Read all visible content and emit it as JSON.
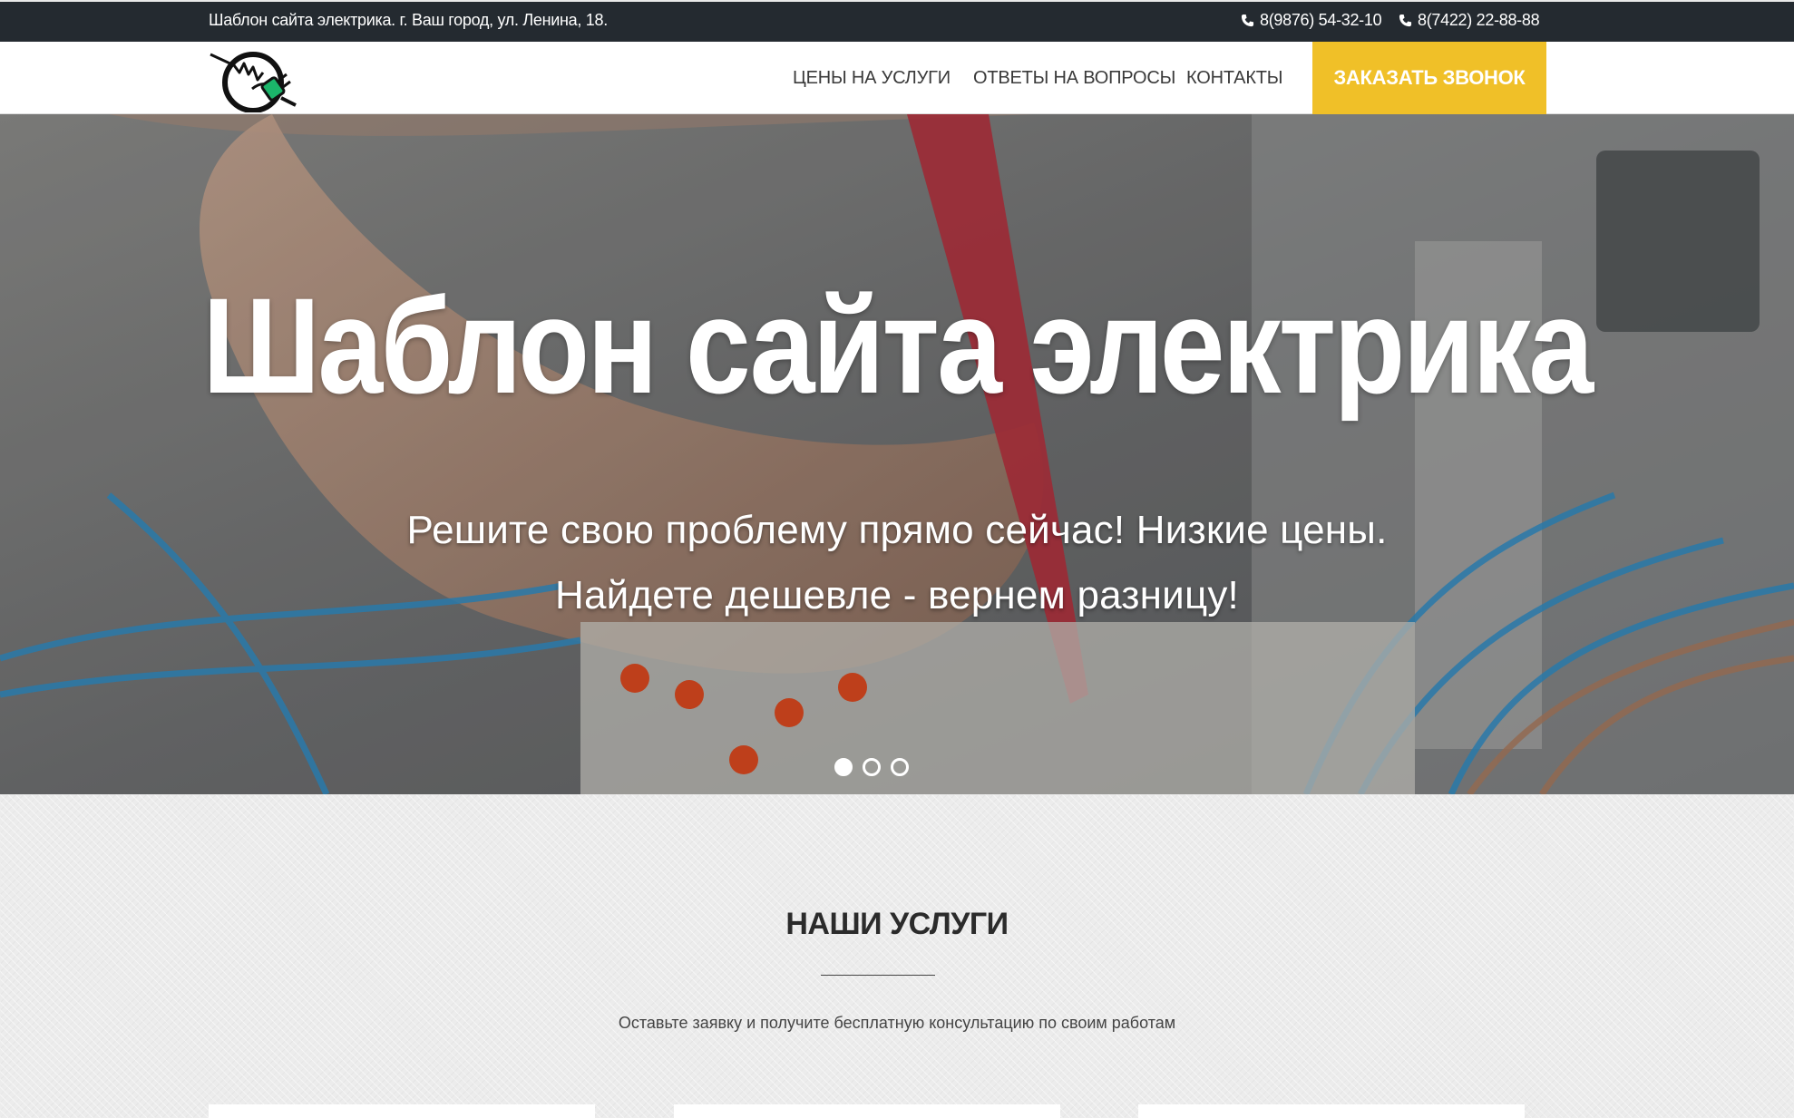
{
  "topbar": {
    "address": "Шаблон сайта электрика. г. Ваш город, ул. Ленина, 18.",
    "phones": [
      "8(9876) 54-32-10",
      "8(7422) 22-88-88"
    ]
  },
  "nav": {
    "items": [
      "ЦЕНЫ НА УСЛУГИ",
      "ОТВЕТЫ НА ВОПРОСЫ",
      "КОНТАКТЫ"
    ],
    "cta": "ЗАКАЗАТЬ ЗВОНОК"
  },
  "hero": {
    "title": "Шаблон сайта электрика",
    "subtitle_line1": "Решите свою проблему прямо сейчас! Низкие цены.",
    "subtitle_line2": "Найдете дешевле - вернем разницу!",
    "slides_count": 3,
    "active_slide": 1
  },
  "services": {
    "heading": "НАШИ УСЛУГИ",
    "lead": "Оставьте заявку и получите бесплатную консультацию по своим работам"
  },
  "colors": {
    "topbar_bg": "#242a30",
    "accent": "#f0c028",
    "logo_green": "#1bb56a"
  }
}
